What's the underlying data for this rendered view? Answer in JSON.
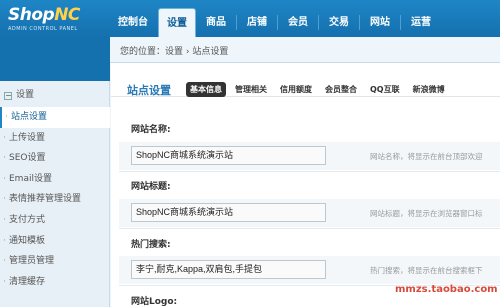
{
  "logo": {
    "main_a": "Shop",
    "main_b": "NC",
    "sub": "ADMIN CONTROL PANEL"
  },
  "nav": [
    "控制台",
    "设置",
    "商品",
    "店铺",
    "会员",
    "交易",
    "网站",
    "运营"
  ],
  "breadcrumb": "您的位置：设置 › 站点设置",
  "sidebar": {
    "head": "设置",
    "items": [
      "站点设置",
      "上传设置",
      "SEO设置",
      "Email设置",
      "表情推荐管理设置",
      "支付方式",
      "通知模板",
      "管理员管理",
      "清理缓存"
    ]
  },
  "main": {
    "section_title": "站点设置",
    "tabs": [
      "基本信息",
      "管理相关",
      "信用额度",
      "会员整合",
      "QQ互联",
      "新浪微博"
    ],
    "fields": [
      {
        "label": "网站名称:",
        "value": "ShopNC商城系统演示站",
        "hint": "网站名称，将显示在前台顶部欢迎"
      },
      {
        "label": "网站标题:",
        "value": "ShopNC商城系统演示站",
        "hint": "网站标题，将显示在浏览器窗口标"
      },
      {
        "label": "热门搜索:",
        "value": "李宁,耐克,Kappa,双肩包,手提包",
        "hint": "热门搜索，将显示在前台搜索框下"
      }
    ],
    "logo_label": "网站Logo:"
  },
  "watermark": "mmzs.taobao.com"
}
